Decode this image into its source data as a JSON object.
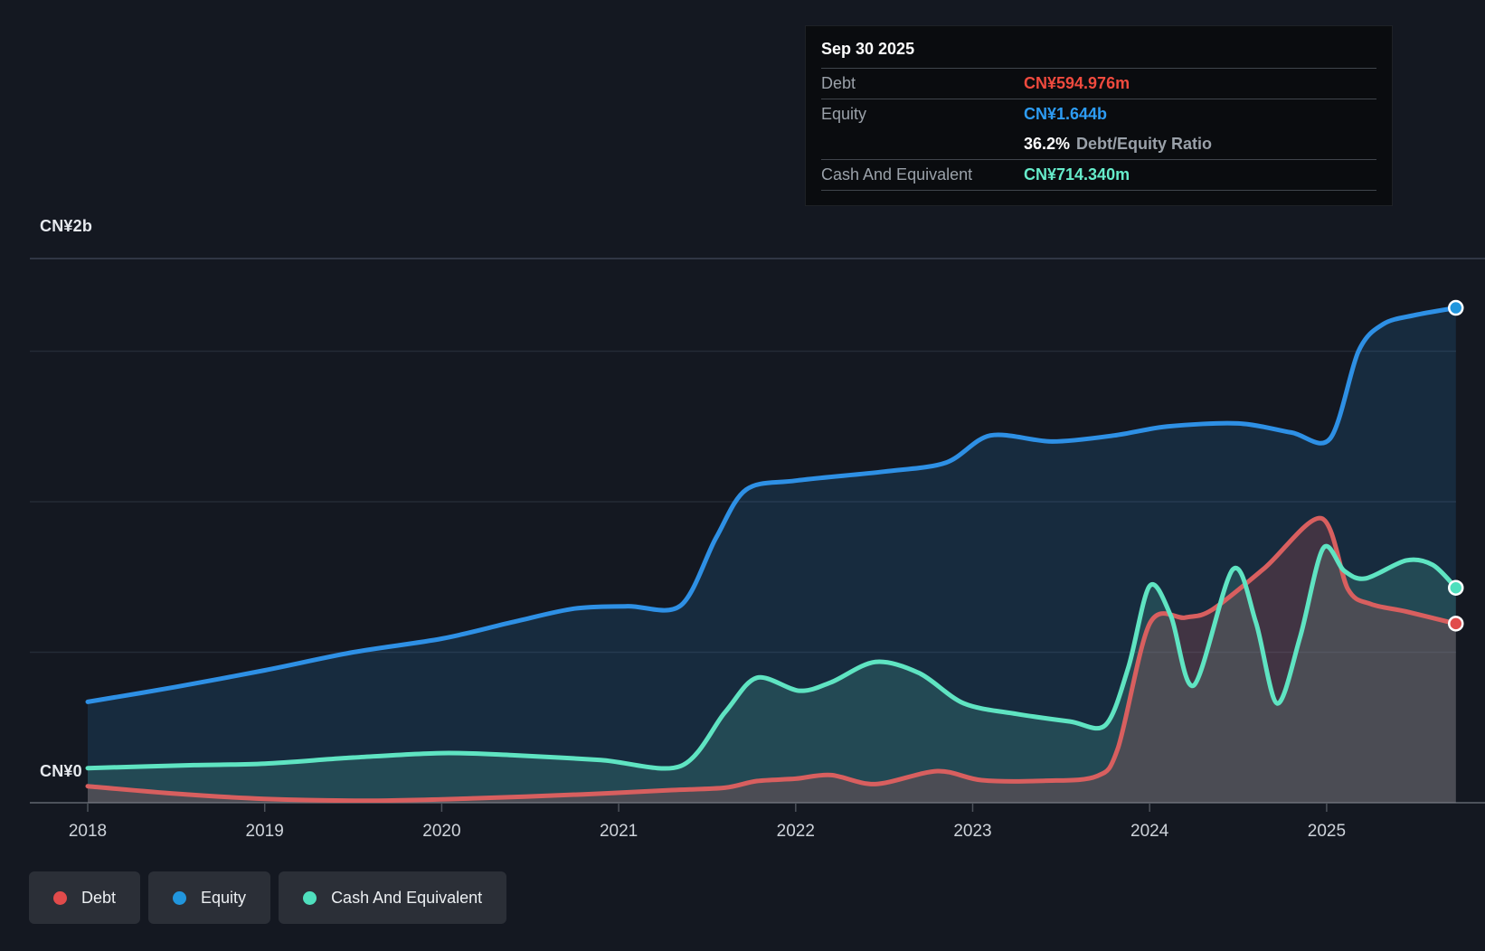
{
  "colors": {
    "debt": "#d85f5f",
    "equity": "#2e90e5",
    "cash": "#5fe4c2",
    "debt_dot": "#e14b4b",
    "equity_dot": "#2196dd",
    "cash_dot": "#4fdfbd",
    "debt_fill": "rgba(220,85,85,0.22)",
    "equity_fill": "rgba(45,140,220,0.16)",
    "cash_fill": "rgba(95,228,195,0.17)",
    "background": "#141821",
    "grid_top": "#3a4150",
    "grid_mid": "#242b36",
    "axis": "#4d525b",
    "year_label": "#ced3da"
  },
  "y_axis": {
    "top_label": "CN¥2b",
    "bottom_label": "CN¥0"
  },
  "x_axis": {
    "years": [
      "2018",
      "2019",
      "2020",
      "2021",
      "2022",
      "2023",
      "2024",
      "2025"
    ]
  },
  "tooltip": {
    "date": "Sep 30 2025",
    "debt_label": "Debt",
    "debt_value": "CN¥594.976m",
    "equity_label": "Equity",
    "equity_value": "CN¥1.644b",
    "ratio_value": "36.2%",
    "ratio_label": "Debt/Equity Ratio",
    "cash_label": "Cash And Equivalent",
    "cash_value": "CN¥714.340m"
  },
  "legend": [
    {
      "key": "debt",
      "label": "Debt"
    },
    {
      "key": "equity",
      "label": "Equity"
    },
    {
      "key": "cash",
      "label": "Cash And Equivalent"
    }
  ],
  "chart_data": {
    "type": "area",
    "x_unit": "decimal_year",
    "xlim": [
      2018,
      2025.75
    ],
    "ylim": [
      0,
      2
    ],
    "ylabel_unit": "CN¥ billions",
    "grid": "horizontal",
    "gridline_values": [
      0.5,
      1.0,
      1.5
    ],
    "x_tick_years": [
      2018,
      2019,
      2020,
      2021,
      2022,
      2023,
      2024,
      2025
    ],
    "last_point_date": "Sep 30 2025",
    "series": [
      {
        "name": "Equity",
        "color_key": "equity",
        "final_value_b": 1.644,
        "points": [
          [
            2018.0,
            0.335
          ],
          [
            2018.5,
            0.385
          ],
          [
            2019.0,
            0.44
          ],
          [
            2019.5,
            0.5
          ],
          [
            2020.0,
            0.545
          ],
          [
            2020.4,
            0.6
          ],
          [
            2020.75,
            0.645
          ],
          [
            2021.05,
            0.653
          ],
          [
            2021.35,
            0.655
          ],
          [
            2021.55,
            0.88
          ],
          [
            2021.72,
            1.04
          ],
          [
            2022.0,
            1.07
          ],
          [
            2022.5,
            1.1
          ],
          [
            2022.85,
            1.13
          ],
          [
            2023.1,
            1.22
          ],
          [
            2023.45,
            1.2
          ],
          [
            2023.8,
            1.22
          ],
          [
            2024.1,
            1.25
          ],
          [
            2024.5,
            1.26
          ],
          [
            2024.8,
            1.23
          ],
          [
            2025.02,
            1.21
          ],
          [
            2025.18,
            1.5
          ],
          [
            2025.32,
            1.59
          ],
          [
            2025.5,
            1.62
          ],
          [
            2025.73,
            1.644
          ]
        ]
      },
      {
        "name": "Debt",
        "color_key": "debt",
        "final_value_b": 0.595,
        "points": [
          [
            2018.0,
            0.055
          ],
          [
            2018.5,
            0.03
          ],
          [
            2019.0,
            0.013
          ],
          [
            2019.6,
            0.007
          ],
          [
            2020.2,
            0.015
          ],
          [
            2020.8,
            0.028
          ],
          [
            2021.3,
            0.042
          ],
          [
            2021.6,
            0.05
          ],
          [
            2021.78,
            0.072
          ],
          [
            2022.0,
            0.08
          ],
          [
            2022.2,
            0.092
          ],
          [
            2022.45,
            0.062
          ],
          [
            2022.8,
            0.105
          ],
          [
            2023.05,
            0.075
          ],
          [
            2023.4,
            0.073
          ],
          [
            2023.7,
            0.088
          ],
          [
            2023.82,
            0.18
          ],
          [
            2024.0,
            0.595
          ],
          [
            2024.2,
            0.615
          ],
          [
            2024.35,
            0.64
          ],
          [
            2024.65,
            0.78
          ],
          [
            2024.97,
            0.945
          ],
          [
            2025.12,
            0.71
          ],
          [
            2025.25,
            0.66
          ],
          [
            2025.45,
            0.635
          ],
          [
            2025.73,
            0.595
          ]
        ]
      },
      {
        "name": "Cash And Equivalent",
        "color_key": "cash",
        "final_value_b": 0.714,
        "points": [
          [
            2018.0,
            0.115
          ],
          [
            2018.6,
            0.125
          ],
          [
            2019.0,
            0.13
          ],
          [
            2019.5,
            0.15
          ],
          [
            2020.0,
            0.165
          ],
          [
            2020.4,
            0.158
          ],
          [
            2020.9,
            0.142
          ],
          [
            2021.35,
            0.122
          ],
          [
            2021.6,
            0.3
          ],
          [
            2021.78,
            0.415
          ],
          [
            2022.02,
            0.372
          ],
          [
            2022.2,
            0.4
          ],
          [
            2022.45,
            0.468
          ],
          [
            2022.7,
            0.43
          ],
          [
            2022.95,
            0.33
          ],
          [
            2023.25,
            0.295
          ],
          [
            2023.55,
            0.27
          ],
          [
            2023.75,
            0.258
          ],
          [
            2023.88,
            0.45
          ],
          [
            2024.0,
            0.72
          ],
          [
            2024.12,
            0.62
          ],
          [
            2024.25,
            0.39
          ],
          [
            2024.47,
            0.775
          ],
          [
            2024.6,
            0.6
          ],
          [
            2024.72,
            0.33
          ],
          [
            2024.85,
            0.55
          ],
          [
            2024.98,
            0.845
          ],
          [
            2025.1,
            0.77
          ],
          [
            2025.22,
            0.745
          ],
          [
            2025.45,
            0.805
          ],
          [
            2025.6,
            0.79
          ],
          [
            2025.73,
            0.714
          ]
        ]
      }
    ]
  }
}
